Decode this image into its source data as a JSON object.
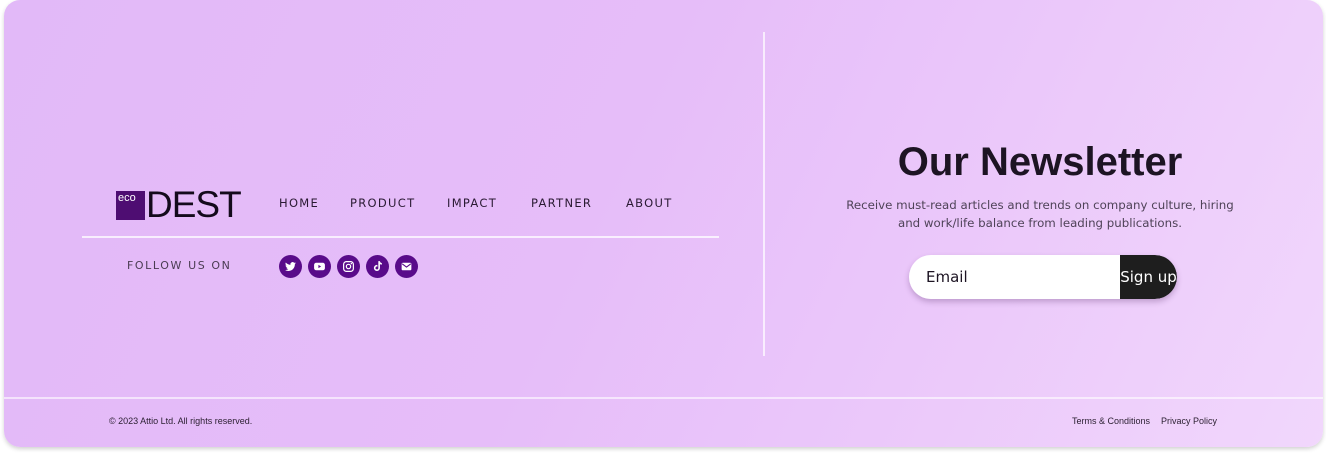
{
  "brand": {
    "logo_prefix": "eco",
    "logo_word": "DEST"
  },
  "nav": {
    "items": [
      {
        "label": "HOME"
      },
      {
        "label": "PRODUCT"
      },
      {
        "label": "IMPACT"
      },
      {
        "label": "PARTNER"
      },
      {
        "label": "ABOUT"
      }
    ]
  },
  "social": {
    "label": "FOLLOW US ON",
    "icons": [
      "twitter-icon",
      "youtube-icon",
      "instagram-icon",
      "tiktok-icon",
      "email-icon"
    ],
    "icon_color": "#590b8a"
  },
  "newsletter": {
    "title": "Our Newsletter",
    "description": "Receive must-read articles and trends on company culture, hiring and work/life balance from leading publications.",
    "email_placeholder": "Email",
    "button_label": "Sign up"
  },
  "bottom": {
    "copyright": "© 2023 Attio Ltd. All rights reserved.",
    "links": [
      {
        "label": "Terms & Conditions"
      },
      {
        "label": "Privacy Policy"
      }
    ]
  },
  "colors": {
    "background_gradient_start": "#e2b9f8",
    "background_gradient_end": "#f1d7fc",
    "brand_purple": "#4e0d72",
    "button_dark": "#1e1e1e"
  }
}
